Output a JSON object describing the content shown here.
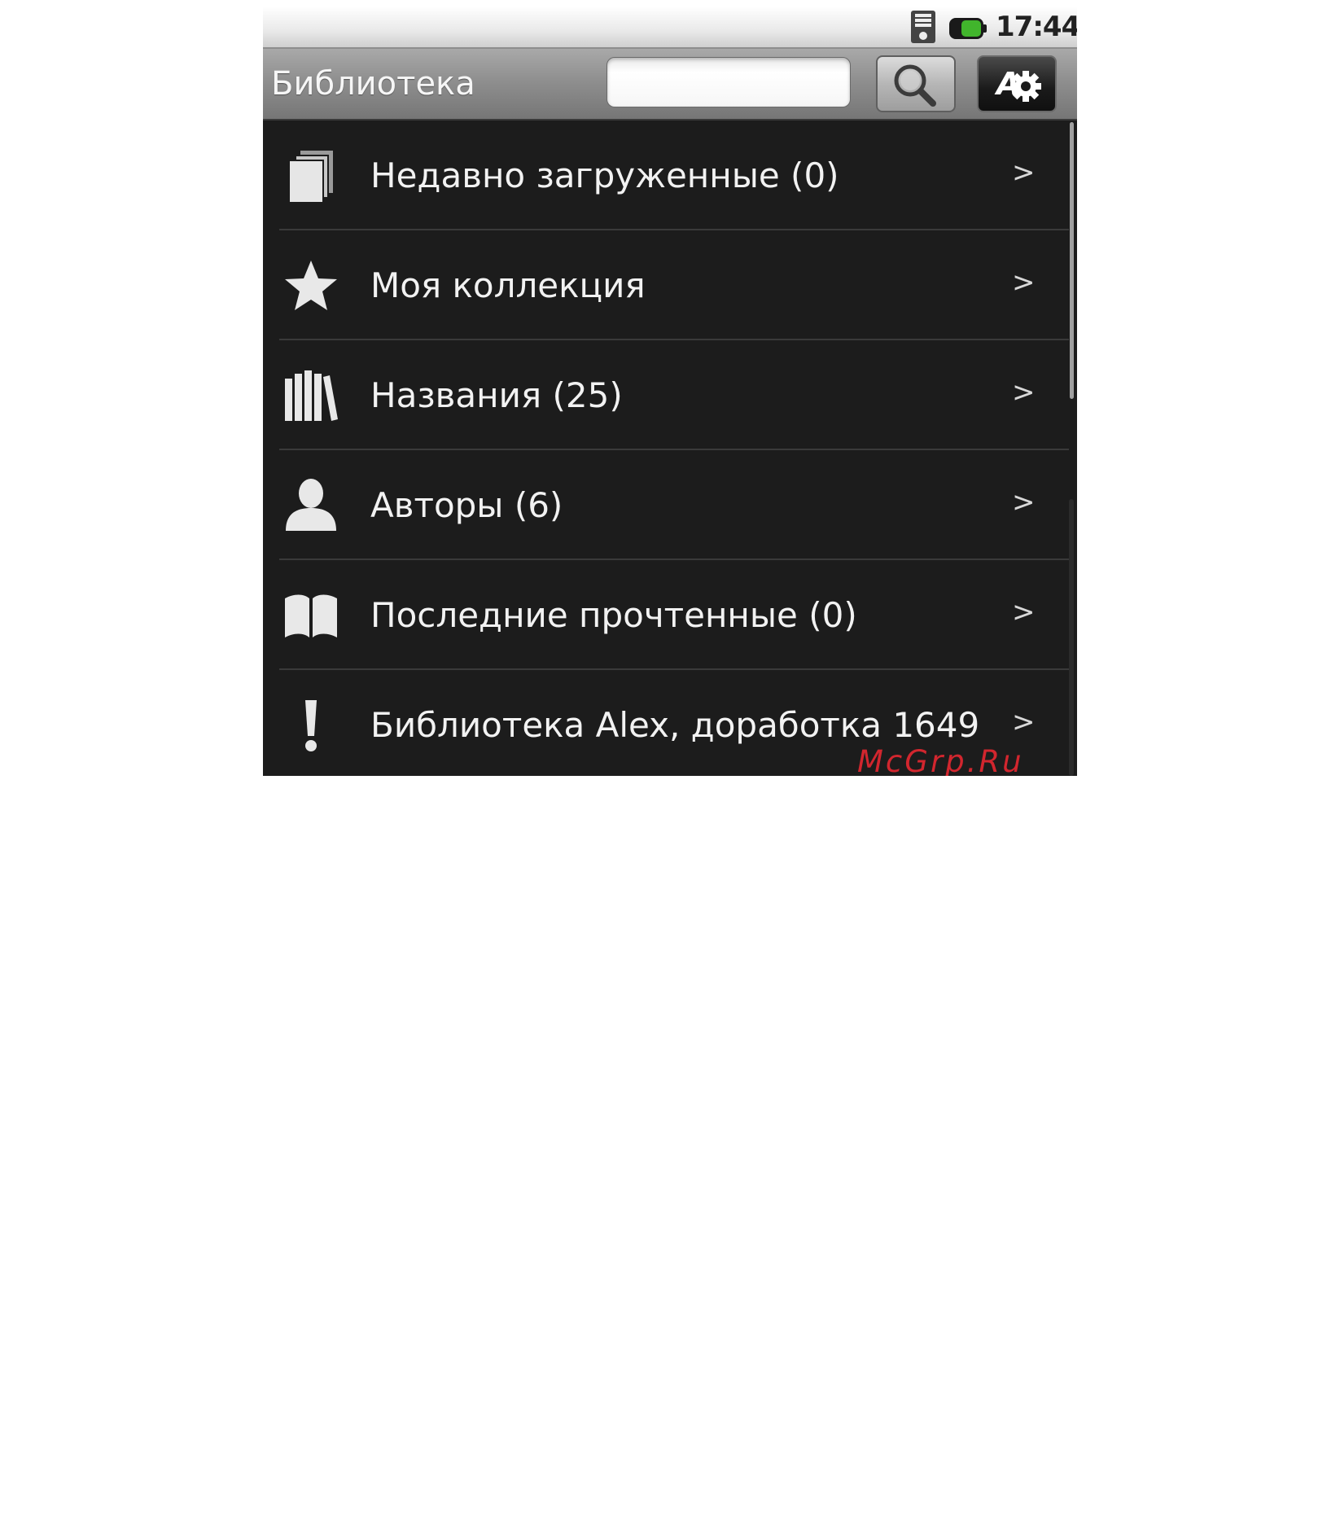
{
  "status_bar": {
    "time": "17:44",
    "icons": [
      "signal-icon",
      "battery-icon"
    ],
    "battery_color": "#3fae2a"
  },
  "header": {
    "title": "Библиотека",
    "search_value": "",
    "search_icon": "search-icon",
    "settings_icon": "settings-gear-icon"
  },
  "list": {
    "items": [
      {
        "icon": "recent-documents-icon",
        "label": "Недавно загруженные (0)",
        "chevron": ">"
      },
      {
        "icon": "star-icon",
        "label": "Моя коллекция",
        "chevron": ">"
      },
      {
        "icon": "books-icon",
        "label": "Названия (25)",
        "chevron": ">"
      },
      {
        "icon": "person-icon",
        "label": "Авторы (6)",
        "chevron": ">"
      },
      {
        "icon": "open-book-icon",
        "label": "Последние прочтенные (0)",
        "chevron": ">"
      },
      {
        "icon": "exclamation-icon",
        "label": "Библиотека Alex, доработка 1649",
        "chevron": ">"
      }
    ]
  },
  "watermark": "McGrp.Ru",
  "colors": {
    "list_background": "#1c1c1c",
    "watermark": "#d2262e"
  }
}
